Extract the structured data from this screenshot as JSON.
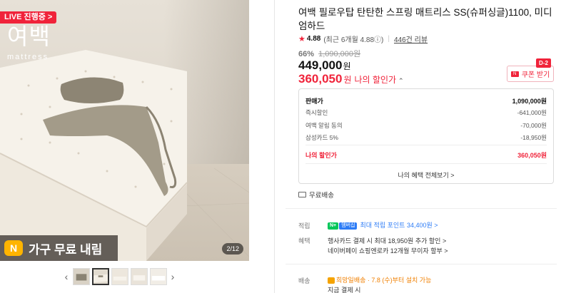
{
  "gallery": {
    "live_badge": "LIVE 진행중 >",
    "brand_ko": "여백",
    "brand_en": "mattress",
    "promo_icon_text": "N",
    "promo_text": "가구 무료 내림",
    "counter": "2/12",
    "prev_arrow": "‹",
    "next_arrow": "›",
    "thumbnail_count": 6,
    "active_thumbnail": 2
  },
  "product": {
    "title": "여백 필로우탑 탄탄한 스프링 매트리스 SS(슈퍼싱글)1100, 미디엄하드",
    "rating": "4.88",
    "rating_recent": "(최근 6개월 4.88ⓘ)",
    "review_count": "446건 리뷰",
    "discount_rate": "66%",
    "original_price": "1,090,000원",
    "sale_price": "449,000",
    "won": "원",
    "my_sale_price": "360,050",
    "my_sale_label": "나의 할인가",
    "coupon_label": "쿠폰 받기",
    "dday": "D-2"
  },
  "price_breakdown": {
    "rows": [
      {
        "label": "판매가",
        "value": "1,090,000원"
      },
      {
        "label": "즉시할인",
        "value": "-641,000원"
      },
      {
        "label": "여백 알림 동의",
        "value": "-70,000원"
      },
      {
        "label": "삼성카드 5%",
        "value": "-18,950원"
      }
    ],
    "total_label": "나의 할인가",
    "total_value": "360,050원",
    "all_benefits_link": "나의 혜택 전체보기 >"
  },
  "shipping": {
    "free_label": "무료배송"
  },
  "info": {
    "points_label": "적립",
    "npay_badge": "N+",
    "membership_badge": "멤버십",
    "points_text": "최대 적립 포인트 34,400원 >",
    "benefits_label": "혜택",
    "benefit_1": "행사카드 결제 시 최대 18,950원 추가 할인 >",
    "benefit_2": "네이버페이 쇼핑엔로카 12개월 무이자 할부 >",
    "delivery_label": "배송",
    "delivery_text": "희망일배송 · 7.8 (수)부터 설치 가능",
    "delivery_sub": "지금 결제 시"
  }
}
